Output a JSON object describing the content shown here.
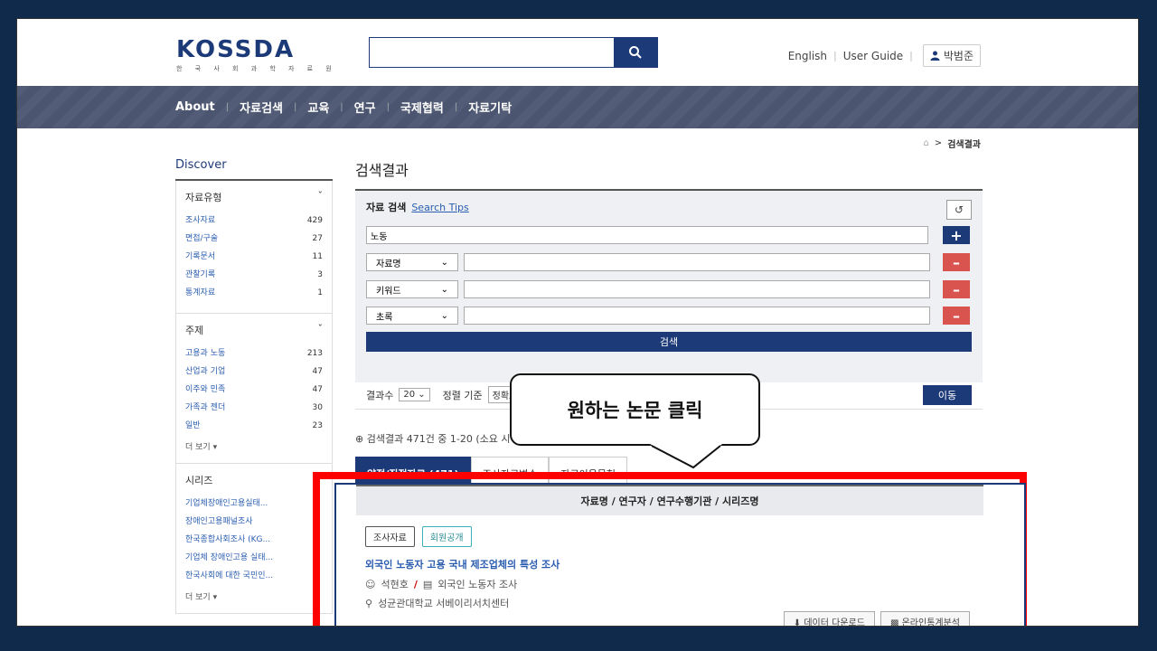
{
  "header": {
    "logo_main": "KOSSDA",
    "logo_sub": "한 국 사 회 과 학 자 료 원",
    "search_value": "",
    "links": [
      "English",
      "User Guide"
    ],
    "user_name": "박범준"
  },
  "nav": {
    "items": [
      "About",
      "자료검색",
      "교육",
      "연구",
      "국제협력",
      "자료기탁"
    ]
  },
  "breadcrumb": {
    "current": "검색결과"
  },
  "sidebar": {
    "title": "Discover",
    "facets": [
      {
        "title": "자료유형",
        "items": [
          {
            "label": "조사자료",
            "count": "429"
          },
          {
            "label": "면접/구술",
            "count": "27"
          },
          {
            "label": "기록문서",
            "count": "11"
          },
          {
            "label": "관찰기록",
            "count": "3"
          },
          {
            "label": "통계자료",
            "count": "1"
          }
        ]
      },
      {
        "title": "주제",
        "items": [
          {
            "label": "고용과 노동",
            "count": "213"
          },
          {
            "label": "산업과 기업",
            "count": "47"
          },
          {
            "label": "이주와 민족",
            "count": "47"
          },
          {
            "label": "가족과 젠더",
            "count": "30"
          },
          {
            "label": "일반",
            "count": "23"
          }
        ],
        "more": "더 보기"
      },
      {
        "title": "시리즈",
        "items": [
          {
            "label": "기업체장애인고용실태..."
          },
          {
            "label": "장애인고용패널조사"
          },
          {
            "label": "한국종합사회조사 (KG..."
          },
          {
            "label": "기업체 장애인고용 실태..."
          },
          {
            "label": "한국사회에 대한 국민인..."
          }
        ],
        "more": "더 보기"
      }
    ]
  },
  "main": {
    "title": "검색결과",
    "panel": {
      "label": "자료 검색",
      "tips": "Search Tips",
      "query": "노동",
      "fields": [
        "자료명",
        "키워드",
        "초록"
      ],
      "submit": "검색"
    },
    "options": {
      "count_label": "결과수",
      "count_value": "20",
      "sort_label": "정렬 기준",
      "sort_value": "정확도",
      "go": "이동"
    },
    "summary": "검색결과 471건 중 1-20 (소요 시",
    "tabs": [
      "양적/질적자료 (471)",
      "조사자료변수",
      "자료이용문헌"
    ],
    "result_header": "자료명 / 연구자 / 연구수행기관 / 시리즈명",
    "result": {
      "badges": [
        "조사자료",
        "회원공개"
      ],
      "title": "외국인 노동자 고용 국내 제조업체의 특성 조사",
      "author": "석현호",
      "series": "외국인 노동자 조사",
      "institution": "성균관대학교 서베이리서치센터",
      "actions": [
        "데이터 다운로드",
        "온라인통계분석"
      ]
    }
  },
  "callout": {
    "text": "원하는 논문 클릭"
  },
  "colors": {
    "navy": "#1d3a78",
    "highlight": "#ff0000",
    "minus": "#d9534f"
  }
}
